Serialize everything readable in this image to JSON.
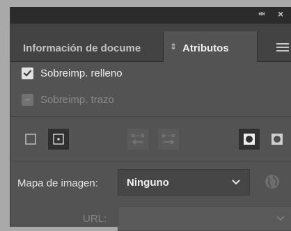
{
  "window": {
    "collapse_icon": "double-chevron-icon",
    "close_icon": "close-icon",
    "collapse_glyph": "««",
    "close_glyph": "×"
  },
  "tabs": {
    "info_label": "Información de docume",
    "attributes_label": "Atributos",
    "attributes_arrows": "⇕",
    "menu_icon": "hamburger-menu-icon"
  },
  "overprint": {
    "fill_label": "Sobreimp. relleno",
    "fill_checked": true,
    "stroke_label": "Sobreimp. trazo",
    "stroke_checked": false,
    "stroke_enabled": false
  },
  "toolbar": {
    "icons": [
      "show-center-off-icon",
      "show-center-on-icon",
      "reverse-path-direction-off-icon",
      "reverse-path-direction-on-icon",
      "nonzero-winding-fill-rule-icon",
      "even-odd-fill-rule-icon"
    ]
  },
  "image_map": {
    "label": "Mapa de imagen:",
    "value": "Ninguno",
    "browser_icon": "globe-icon"
  },
  "url": {
    "label": "URL:",
    "value": ""
  },
  "colors": {
    "panel_bg": "#535353",
    "tab_bar_bg": "#434343",
    "title_bar_bg": "#2b2b2b",
    "text_active": "#f0f0f0",
    "text_disabled": "#8a8a8a"
  }
}
